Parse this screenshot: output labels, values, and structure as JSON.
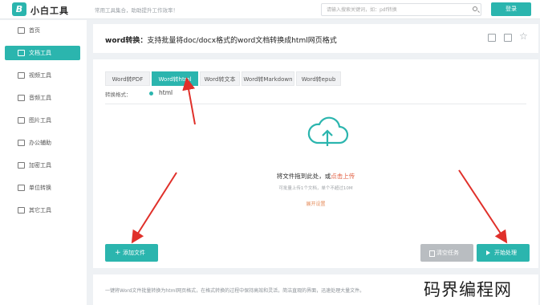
{
  "header": {
    "logo_letter": "B",
    "app_name": "小白工具",
    "slogan": "常用工具集合，助助提升工作效率！",
    "search_placeholder": "请输入搜索关键词，如：pdf转换",
    "login_label": "登录"
  },
  "sidebar": {
    "items": [
      {
        "label": "首页",
        "icon": "home-icon"
      },
      {
        "label": "文档工具",
        "icon": "document-icon",
        "active": true
      },
      {
        "label": "视频工具",
        "icon": "video-icon"
      },
      {
        "label": "音频工具",
        "icon": "music-icon"
      },
      {
        "label": "图片工具",
        "icon": "image-icon"
      },
      {
        "label": "办公辅助",
        "icon": "office-icon"
      },
      {
        "label": "加密工具",
        "icon": "lock-icon"
      },
      {
        "label": "单位转换",
        "icon": "unit-icon"
      },
      {
        "label": "其它工具",
        "icon": "more-icon"
      }
    ]
  },
  "page": {
    "title_bold": "word转换：",
    "title_rest": "支持批量将doc/docx格式的word文档转换成html网页格式"
  },
  "tabs": [
    {
      "label": "Word转PDF"
    },
    {
      "label": "Word转html",
      "active": true
    },
    {
      "label": "Word转文本"
    },
    {
      "label": "Word转Markdown"
    },
    {
      "label": "Word转epub"
    }
  ],
  "format": {
    "label": "转换格式：",
    "value": "html"
  },
  "upload": {
    "drop_text": "将文件拖到此处，或",
    "click_text": "点击上传",
    "limit_text": "可批量上传1个文档，单个不超过10M",
    "advanced_text": "展开设置"
  },
  "buttons": {
    "add_file": "添加文件",
    "clear": "清空任务",
    "start": "开始处理"
  },
  "footer": {
    "text": "一键将Word文件批量转换为html网页格式，在格式转换的过程中保持高效和灵活，简洁直观的界面，迅速处理大量文件。"
  },
  "watermark": "码界编程网",
  "colors": {
    "accent": "#2bb5ae",
    "arrow": "#e0302a",
    "link": "#e05a3b"
  }
}
